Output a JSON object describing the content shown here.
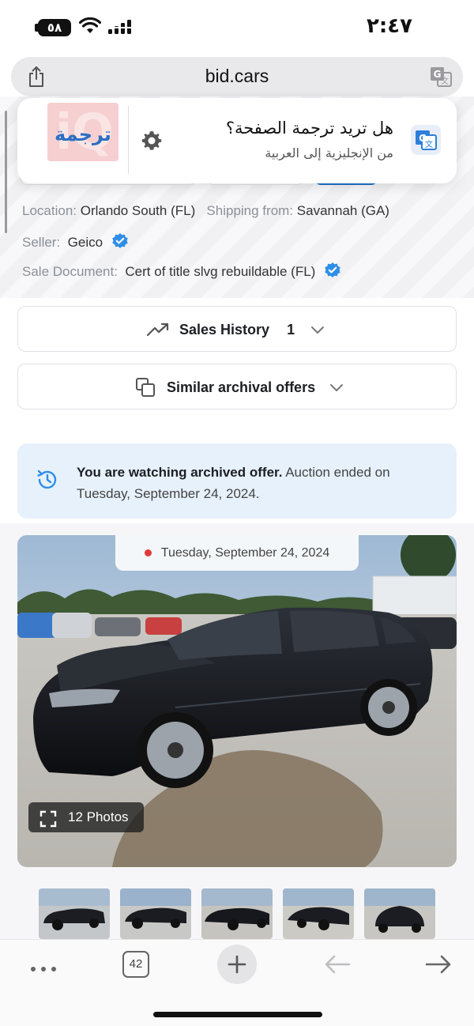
{
  "status_bar": {
    "time": "٢:٤٧",
    "battery": "٥٨"
  },
  "url_bar": {
    "domain": "bid.cars"
  },
  "translate_popup": {
    "title": "هل تريد ترجمة الصفحة؟",
    "subtitle": "من الإنجليزية إلى العربية",
    "logo_text": "ترجمة"
  },
  "details": {
    "location_label": "Location:",
    "location_value": "Orlando South (FL)",
    "shipping_label": "Shipping from:",
    "shipping_value": "Savannah (GA)",
    "seller_label": "Seller:",
    "seller_value": "Geico",
    "doc_label": "Sale Document:",
    "doc_value": "Cert of title slvg rebuildable (FL)"
  },
  "sales_history": {
    "label": "Sales History",
    "count": "1"
  },
  "similar": {
    "label": "Similar archival offers"
  },
  "archive_banner": {
    "bold": "You are watching archived offer.",
    "rest": " Auction ended on Tuesday, September 24, 2024."
  },
  "photo": {
    "date": "Tuesday, September 24, 2024",
    "photos_count_label": "12 Photos",
    "car_color": "#15171c"
  },
  "toolbar": {
    "tab_count": "42"
  },
  "colors": {
    "verified": "#2f8ee8",
    "accent_blue": "#1d6fc2"
  }
}
